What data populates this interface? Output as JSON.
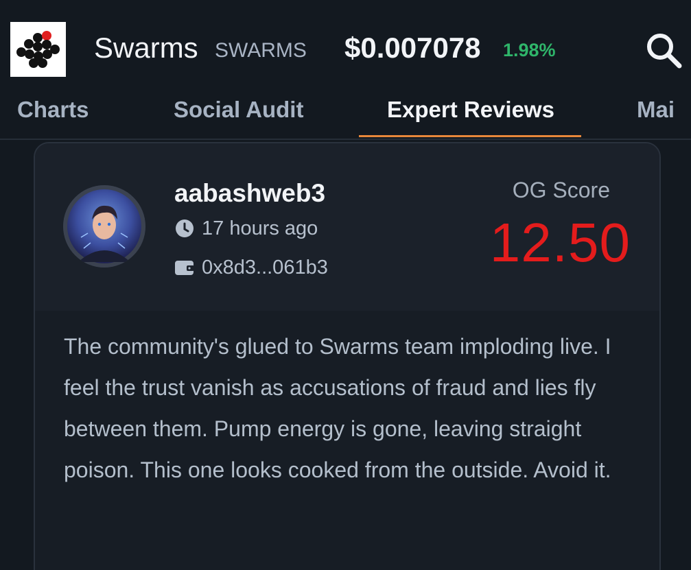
{
  "header": {
    "logo_icon": "swarms-hexagon-logo",
    "name": "Swarms",
    "symbol": "SWARMS",
    "price": "$0.007078",
    "change": "1.98%",
    "change_color": "#2fb56a",
    "search_icon": "search-icon"
  },
  "tabs": [
    {
      "label": "Charts",
      "active": false
    },
    {
      "label": "Social Audit",
      "active": false
    },
    {
      "label": "Expert Reviews",
      "active": true
    },
    {
      "label": "Mai",
      "active": false
    }
  ],
  "review": {
    "reviewer": "aabashweb3",
    "time": "17 hours ago",
    "wallet": "0x8d3...061b3",
    "score_label": "OG Score",
    "score": "12.50",
    "score_color": "#e41c1c",
    "text": "The community's glued to Swarms team imploding live. I feel the trust vanish as accusations of fraud and lies fly between them. Pump energy is gone, leaving straight poison. This one looks cooked from the outside. Avoid it."
  },
  "colors": {
    "background": "#131920",
    "card": "#1b212a",
    "accent_underline": "#e8883a"
  }
}
